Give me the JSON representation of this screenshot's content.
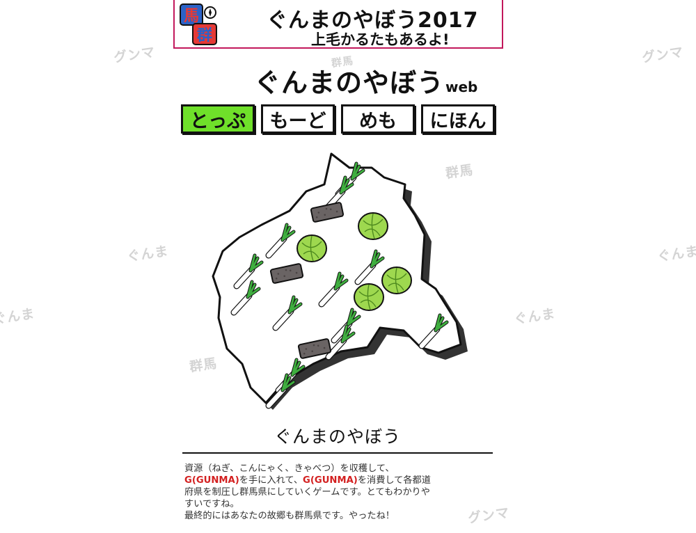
{
  "banner": {
    "logo_text_top": "馬",
    "logo_text_bottom": "群",
    "title": "ぐんまのやぼう2017",
    "subtitle": "上毛かるたもあるよ!"
  },
  "site": {
    "title": "ぐんまのやぼう",
    "title_suffix": "web"
  },
  "nav": {
    "items": [
      {
        "label": "とっぷ",
        "active": true
      },
      {
        "label": "もーど",
        "active": false
      },
      {
        "label": "めも",
        "active": false
      },
      {
        "label": "にほん",
        "active": false
      }
    ]
  },
  "watermarks": [
    "グンマ",
    "グンマ",
    "群馬",
    "ぐんま",
    "ぐんま",
    "ぐんま",
    "ぐんま",
    "群馬",
    "グンマ",
    "群馬"
  ],
  "description": {
    "title": "ぐんまのやぼう",
    "line1": "資源（ねぎ、こんにゃく、きゃべつ）を収穫して、",
    "line2_hl1": "G(GUNMA)",
    "line2_mid": "を手に入れて、",
    "line2_hl2": "G(GUNMA)",
    "line2_end": "を消費して各都道",
    "line3": "府県を制圧し群馬県にしていくゲームです。とてもわかりや",
    "line4": "すいですね。",
    "line5": "最終的にはあなたの故郷も群馬県です。やったね！"
  },
  "colors": {
    "banner_border": "#c2185b",
    "nav_active": "#6fe02a",
    "highlight": "#d32020",
    "cabbage": "#9ed84f",
    "konnyaku": "#6a6464",
    "negi_green": "#3fae3f"
  }
}
